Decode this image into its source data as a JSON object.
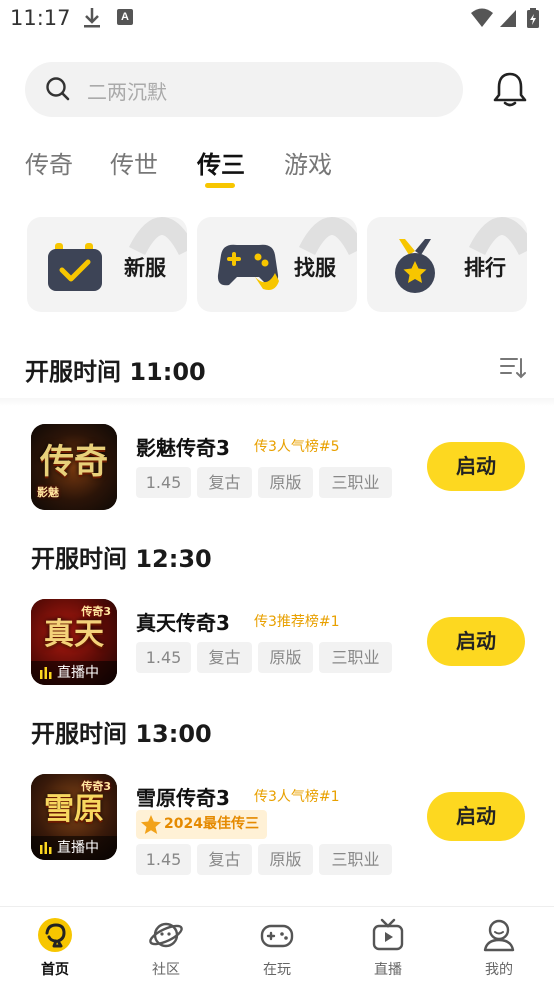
{
  "status_bar": {
    "time": "11:17",
    "a_badge": "A"
  },
  "search": {
    "placeholder": "二两沉默"
  },
  "tabs": [
    {
      "label": "传奇",
      "active": false
    },
    {
      "label": "传世",
      "active": false
    },
    {
      "label": "传三",
      "active": true
    },
    {
      "label": "游戏",
      "active": false
    }
  ],
  "quick_entries": [
    {
      "label": "新服",
      "icon": "calendar-check-icon"
    },
    {
      "label": "找服",
      "icon": "gamepad-icon"
    },
    {
      "label": "排行",
      "icon": "medal-icon"
    }
  ],
  "accent_color": "#fdd820",
  "sections": [
    {
      "title": "开服时间  11:00",
      "game": {
        "name": "影魅传奇3",
        "rank": "传3人气榜#5",
        "thumb_title": "传奇",
        "thumb_sub": "影魅",
        "live": "",
        "award": "",
        "tags": [
          "1.45",
          "复古",
          "原版",
          "三职业"
        ],
        "button": "启动"
      }
    },
    {
      "title": "开服时间  12:30",
      "game": {
        "name": "真天传奇3",
        "rank": "传3推荐榜#1",
        "thumb_title": "真天",
        "thumb_sub": "传奇3",
        "live": "直播中",
        "award": "",
        "tags": [
          "1.45",
          "复古",
          "原版",
          "三职业"
        ],
        "button": "启动"
      }
    },
    {
      "title": "开服时间  13:00",
      "game": {
        "name": "雪原传奇3",
        "rank": "传3人气榜#1",
        "thumb_title": "雪原",
        "thumb_sub": "传奇3",
        "live": "直播中",
        "award": "2024最佳传三",
        "tags": [
          "1.45",
          "复古",
          "原版",
          "三职业"
        ],
        "button": "启动"
      }
    }
  ],
  "bottom_nav": [
    {
      "label": "首页",
      "icon": "home-icon",
      "active": true
    },
    {
      "label": "社区",
      "icon": "planet-icon",
      "active": false
    },
    {
      "label": "在玩",
      "icon": "gamepad-icon",
      "active": false
    },
    {
      "label": "直播",
      "icon": "tv-icon",
      "active": false
    },
    {
      "label": "我的",
      "icon": "user-icon",
      "active": false
    }
  ]
}
